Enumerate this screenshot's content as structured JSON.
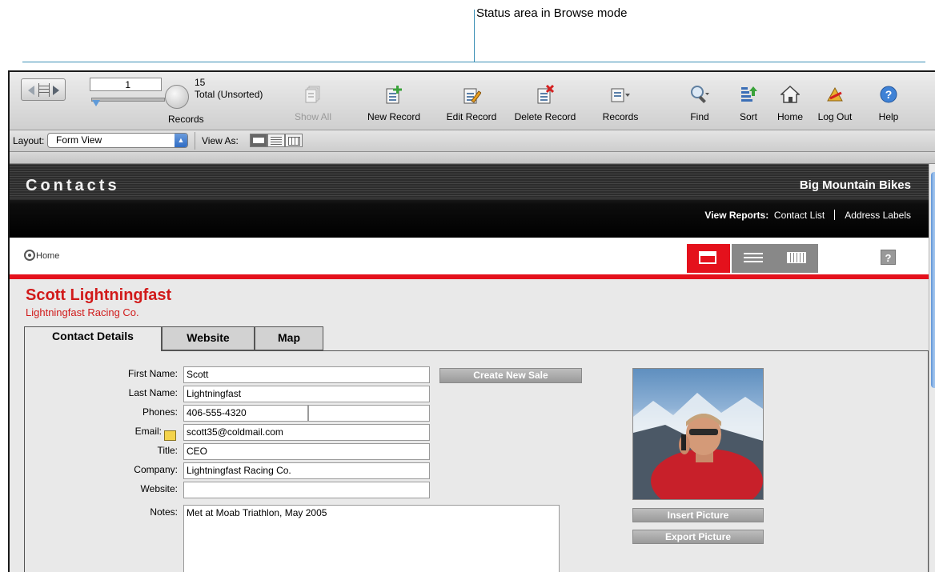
{
  "callout": {
    "text": "Status area in Browse mode"
  },
  "toolbar": {
    "record_number": "1",
    "total_count": "15",
    "total_state": "Total (Unsorted)",
    "records_label": "Records",
    "buttons": [
      {
        "label": "Show All",
        "icon": "show-all-icon",
        "enabled": false
      },
      {
        "label": "New Record",
        "icon": "new-record-icon",
        "enabled": true
      },
      {
        "label": "Edit Record",
        "icon": "edit-record-icon",
        "enabled": true
      },
      {
        "label": "Delete Record",
        "icon": "delete-record-icon",
        "enabled": true
      },
      {
        "label": "Records",
        "icon": "records-menu-icon",
        "enabled": true
      },
      {
        "label": "Find",
        "icon": "find-icon",
        "enabled": true
      },
      {
        "label": "Sort",
        "icon": "sort-icon",
        "enabled": true
      },
      {
        "label": "Home",
        "icon": "home-icon",
        "enabled": true
      },
      {
        "label": "Log Out",
        "icon": "log-out-icon",
        "enabled": true
      },
      {
        "label": "Help",
        "icon": "help-icon",
        "enabled": true
      }
    ]
  },
  "layoutbar": {
    "layout_label": "Layout:",
    "layout_value": "Form View",
    "view_as_label": "View As:",
    "view_as_selected": "form"
  },
  "header": {
    "title": "Contacts",
    "company": "Big Mountain Bikes",
    "reports_label": "View Reports:",
    "report_links": [
      "Contact List",
      "Address Labels"
    ]
  },
  "nav": {
    "home_label": "Home",
    "help_label": "?"
  },
  "contact": {
    "name": "Scott Lightningfast",
    "company_subtitle": "Lightningfast Racing Co."
  },
  "tabs": [
    "Contact Details",
    "Website",
    "Map"
  ],
  "form": {
    "first_name_label": "First Name:",
    "first_name": "Scott",
    "last_name_label": "Last Name:",
    "last_name": "Lightningfast",
    "phones_label": "Phones:",
    "phone1": "406-555-4320",
    "phone2": "",
    "email_label": "Email:",
    "email": "scott35@coldmail.com",
    "title_label": "Title:",
    "title": "CEO",
    "company_label": "Company:",
    "company": "Lightningfast Racing Co.",
    "website_label": "Website:",
    "website": "",
    "notes_label": "Notes:",
    "notes": "Met at Moab Triathlon, May 2005",
    "create_sale": "Create New Sale",
    "insert_picture": "Insert Picture",
    "export_picture": "Export Picture"
  },
  "colors": {
    "accent": "#e4111c",
    "name_red": "#d11a1a",
    "header_bg": "#1a1a1a"
  }
}
